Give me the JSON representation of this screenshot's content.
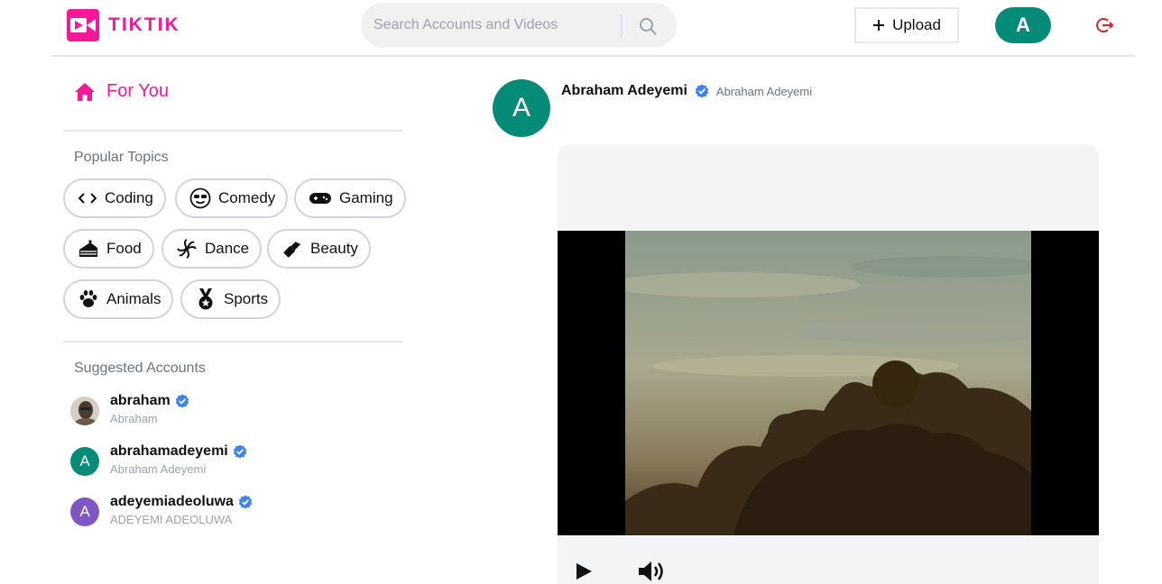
{
  "brand": {
    "name": "TIKTIK",
    "color": "#f51997"
  },
  "search": {
    "placeholder": "Search Accounts and Videos",
    "icon": "search-icon"
  },
  "header": {
    "upload_label": "Upload",
    "user_initial": "A",
    "logout_icon": "logout-icon"
  },
  "sidebar": {
    "for_you": {
      "label": "For You",
      "icon": "home-icon"
    },
    "popular_title": "Popular Topics",
    "topics": [
      {
        "label": "Coding",
        "icon": "code-icon"
      },
      {
        "label": "Comedy",
        "icon": "sunglasses-face-icon"
      },
      {
        "label": "Gaming",
        "icon": "gamepad-icon"
      },
      {
        "label": "Food",
        "icon": "cake-icon"
      },
      {
        "label": "Dance",
        "icon": "dance-icon"
      },
      {
        "label": "Beauty",
        "icon": "lipstick-icon"
      },
      {
        "label": "Animals",
        "icon": "paw-icon"
      },
      {
        "label": "Sports",
        "icon": "medal-icon"
      }
    ],
    "suggested_title": "Suggested Accounts",
    "accounts": [
      {
        "username": "abraham",
        "name": "Abraham",
        "avatar": "photo",
        "avatar_color": "#9a8a78"
      },
      {
        "username": "abrahamadeyemi",
        "name": "Abraham Adeyemi",
        "initial": "A",
        "avatar_color": "#078b79"
      },
      {
        "username": "adeyemiadeoluwa",
        "name": "ADEYEMI ADEOLUWA",
        "initial": "A",
        "avatar_color": "#7e57c2"
      }
    ]
  },
  "post": {
    "initial": "A",
    "username": "Abraham Adeyemi",
    "name": "Abraham Adeyemi",
    "verified": true,
    "controls": {
      "play_icon": "play-icon",
      "volume_icon": "volume-icon"
    }
  },
  "colors": {
    "accent": "#f51997",
    "avatar_teal": "#078b79",
    "verified_blue": "#3b82f6"
  }
}
